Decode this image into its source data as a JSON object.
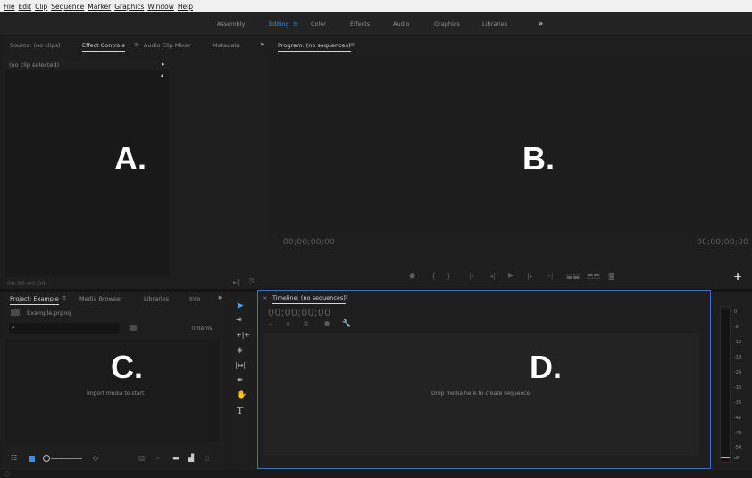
{
  "menu": [
    "File",
    "Edit",
    "Clip",
    "Sequence",
    "Marker",
    "Graphics",
    "Window",
    "Help"
  ],
  "workspaces": {
    "items": [
      "Assembly",
      "Editing",
      "Color",
      "Effects",
      "Audio",
      "Graphics",
      "Libraries"
    ],
    "active": "Editing",
    "menu_glyph": "≡",
    "overflow": "»"
  },
  "source_panel": {
    "tabs": [
      "Source: (no clips)",
      "Effect Controls",
      "Audio Clip Mixer",
      "Metadata"
    ],
    "active_tab": "Effect Controls",
    "overflow": "»",
    "no_clip": "(no clip selected)",
    "timecode": "00;00;00;00",
    "label": "A."
  },
  "program_panel": {
    "title": "Program: (no sequences)",
    "menu_glyph": "≡",
    "timecode_left": "00;00;00;00",
    "timecode_right": "00;00;00;00",
    "label": "B.",
    "add_glyph": "+"
  },
  "project_panel": {
    "tabs": [
      "Project: Example",
      "Media Browser",
      "Libraries",
      "Info"
    ],
    "active_tab": "Project: Example",
    "menu_glyph": "≡",
    "overflow": "»",
    "file_name": "Example.prproj",
    "search_placeholder": "",
    "item_count": "0 Items",
    "empty_text": "Import media to start",
    "label": "C."
  },
  "timeline_panel": {
    "close_glyph": "×",
    "title": "Timeline: (no sequences)",
    "menu_glyph": "≡",
    "timecode": "00;00;00;00",
    "empty_text": "Drop media here to create sequence.",
    "label": "D."
  },
  "audio_meter": {
    "scale": [
      "0",
      "-6",
      "-12",
      "-18",
      "-24",
      "-30",
      "-36",
      "-42",
      "-48",
      "-54",
      "dB"
    ]
  },
  "tools": [
    "selection-tool",
    "track-select-tool",
    "ripple-edit-tool",
    "razor-tool",
    "slip-tool",
    "pen-tool",
    "hand-tool",
    "type-tool"
  ],
  "colors": {
    "accent": "#3a8eea",
    "panel_bg": "#1e1e1e",
    "inner_bg": "#232323",
    "meter_level": "#d8c22a"
  }
}
